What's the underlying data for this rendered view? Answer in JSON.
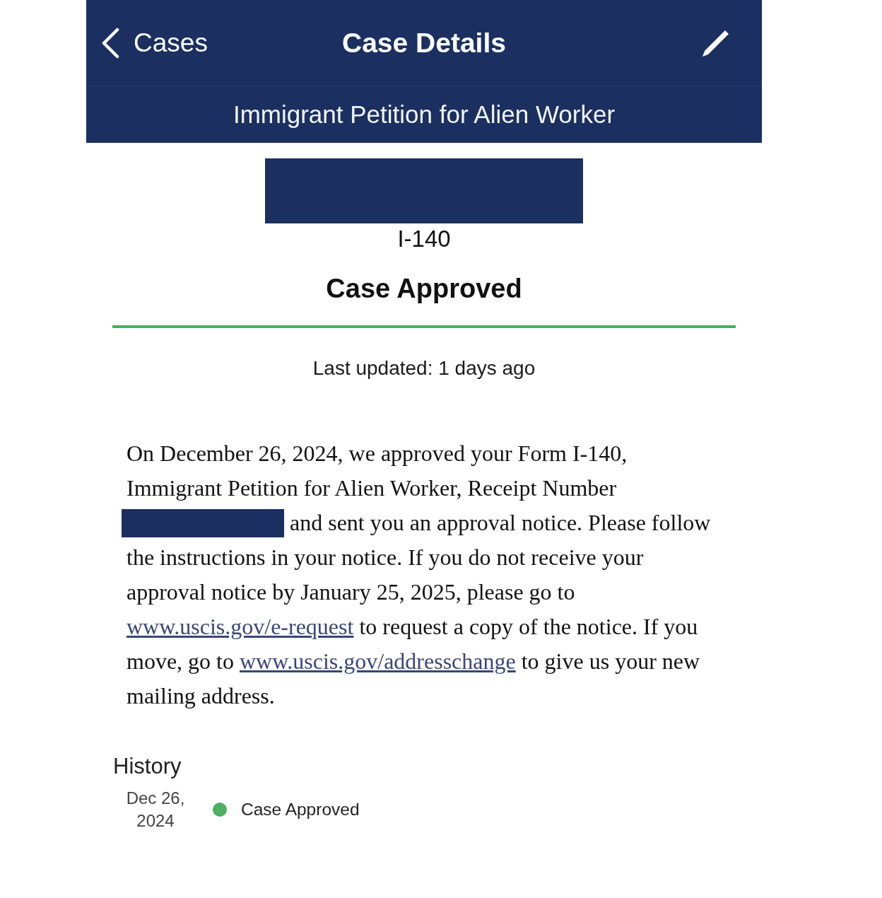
{
  "nav_bar": {
    "back_label": "Cases",
    "title": "Case Details"
  },
  "subtitle": "Immigrant Petition for Alien Worker",
  "case": {
    "receipt_redacted": true,
    "form": "I-140",
    "status": "Case Approved",
    "last_updated": "Last updated: 1 days ago"
  },
  "message": [
    {
      "kind": "text",
      "text": "On December 26, 2024, we approved your Form I-140, Immigrant Petition for Alien Worker, Receipt Number "
    },
    {
      "kind": "redaction"
    },
    {
      "kind": "text",
      "text": " and sent you an approval notice. Please follow the instructions in your notice. If you do not receive your approval notice by January 25, 2025, please go to "
    },
    {
      "kind": "link",
      "text": "www.uscis.gov/e-request"
    },
    {
      "kind": "text",
      "text": " to request a copy of the notice. If you move, go to "
    },
    {
      "kind": "link",
      "text": "www.uscis.gov/addresschange"
    },
    {
      "kind": "text",
      "text": " to give us your new mailing address."
    }
  ],
  "history": {
    "title": "History",
    "entries": [
      {
        "date": "Dec 26, 2024",
        "status": "Case Approved",
        "color": "#4caf61"
      }
    ]
  }
}
